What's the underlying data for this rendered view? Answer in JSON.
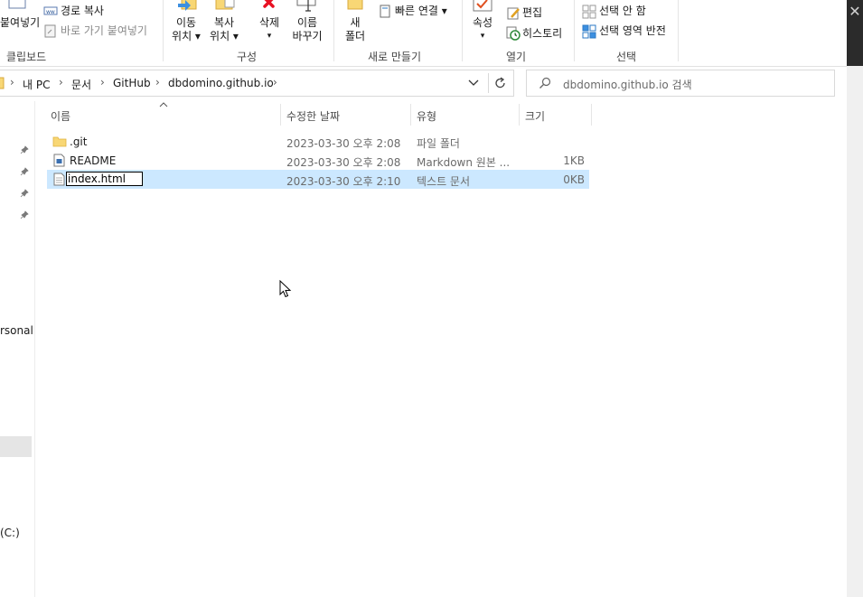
{
  "ribbon": {
    "clipboard": {
      "paste_label": "붙여넣기",
      "copy_path_label": "경로 복사",
      "paste_shortcut_label": "바로 가기 붙여넣기",
      "group_label": "클립보드"
    },
    "organize": {
      "move_to_line1": "이동",
      "move_to_line2": "위치 ▾",
      "copy_to_line1": "복사",
      "copy_to_line2": "위치 ▾",
      "delete_label": "삭제",
      "delete_arrow": "▾",
      "rename_line1": "이름",
      "rename_line2": "바꾸기",
      "group_label": "구성"
    },
    "new": {
      "new_folder_line1": "새",
      "new_folder_line2": "폴더",
      "easy_access_label": "빠른 연결 ▾",
      "group_label": "새로 만들기"
    },
    "open": {
      "properties_label": "속성",
      "properties_arrow": "▾",
      "edit_label": "편집",
      "history_label": "히스토리",
      "group_label": "열기"
    },
    "select": {
      "select_none_label": "선택 안 함",
      "invert_selection_label": "선택 영역 반전",
      "group_label": "선택"
    }
  },
  "address": {
    "breadcrumbs": [
      "내 PC",
      "문서",
      "GitHub",
      "dbdomino.github.io"
    ],
    "search_placeholder": "dbdomino.github.io 검색"
  },
  "nav_pane": {
    "partial_label_1": "rsonal",
    "partial_label_2": "(C:)"
  },
  "columns": {
    "name": "이름",
    "date_modified": "수정한 날짜",
    "type": "유형",
    "size": "크기"
  },
  "files": [
    {
      "name": ".git",
      "date": "2023-03-30 오후 2:08",
      "type": "파일 폴더",
      "size": "",
      "icon": "folder-icon"
    },
    {
      "name": "README",
      "date": "2023-03-30 오후 2:08",
      "type": "Markdown 원본 ...",
      "size": "1KB",
      "icon": "markdown-file-icon"
    },
    {
      "name": "index.html",
      "date": "2023-03-30 오후 2:10",
      "type": "텍스트 문서",
      "size": "0KB",
      "icon": "text-file-icon"
    }
  ],
  "colors": {
    "selection": "#cce8ff",
    "folder": "#f8d775",
    "delete_red": "#e81123"
  }
}
